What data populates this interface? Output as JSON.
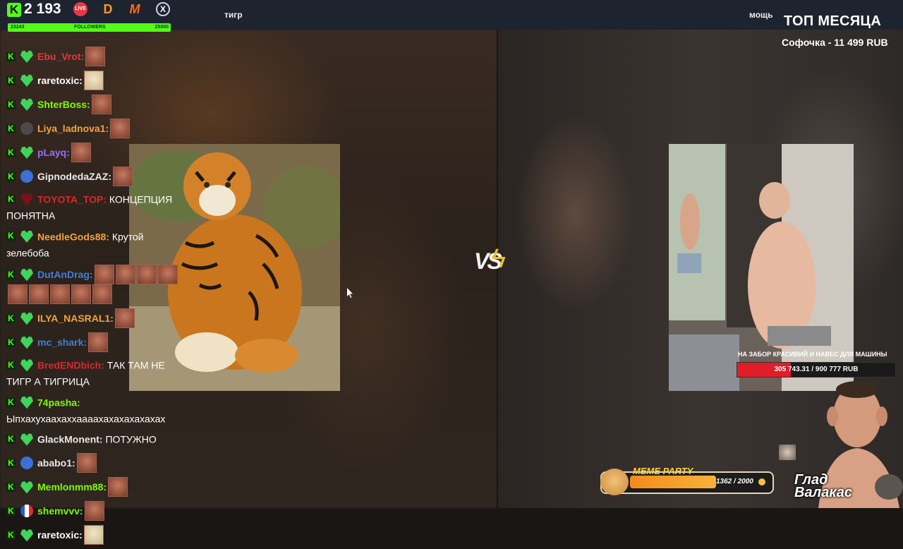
{
  "header": {
    "viewers": "2 193",
    "followers": {
      "current": "23243",
      "label": "FOLLOWERS",
      "goal": "25000",
      "progress": 0.93
    },
    "platforms": [
      {
        "icon": "live-icon",
        "label": "LIVE"
      },
      {
        "icon": "donationalerts-icon",
        "label": "D"
      },
      {
        "icon": "memealerts-icon",
        "label": "M"
      },
      {
        "icon": "x-icon",
        "label": "X"
      }
    ],
    "caption_left": "тигр",
    "caption_right": "мощь",
    "top_month_title": "ТОП МЕСЯЦА",
    "top_donor": "Софочка - 11 499 RUB"
  },
  "chat": [
    {
      "user": "Ebu_Vrot:",
      "color": "#e5383b",
      "badge": "heart",
      "text": ""
    },
    {
      "user": "raretoxic:",
      "color": "#ffffff",
      "badge": "heart",
      "text": ""
    },
    {
      "user": "ShterBoss:",
      "color": "#7cfc00",
      "badge": "heart",
      "text": ""
    },
    {
      "user": "Liya_ladnova1:",
      "color": "#f4a23a",
      "badge": "dark",
      "text": ""
    },
    {
      "user": "pLayq:",
      "color": "#9b6cff",
      "badge": "heart",
      "text": ""
    },
    {
      "user": "GipnodedaZAZ:",
      "color": "#e8e8e8",
      "badge": "blue",
      "text": ""
    },
    {
      "user": "TOYOTA_TOP:",
      "color": "#d62a2a",
      "badge": "red",
      "text": "КОНЦЕПЦИЯ ПОНЯТНА"
    },
    {
      "user": "NeedleGods88:",
      "color": "#f4a23a",
      "badge": "heart",
      "text": "Крутой зелебоба"
    },
    {
      "user": "DutAnDrag:",
      "color": "#3f7fe0",
      "badge": "heart",
      "text": ""
    },
    {
      "user": "ILYA_NASRAL1:",
      "color": "#f4a23a",
      "badge": "heart",
      "text": ""
    },
    {
      "user": "mc_shark:",
      "color": "#3f7fe0",
      "badge": "heart",
      "text": ""
    },
    {
      "user": "BredENDbich:",
      "color": "#d62a2a",
      "badge": "heart",
      "text": "ТАК ТАМ НЕ ТИГР А ТИГРИЦА"
    },
    {
      "user": "74pasha:",
      "color": "#7cfc00",
      "badge": "heart",
      "text": "Ыпхахухаахаххаааахахахахахахах"
    },
    {
      "user": "GlackMonent:",
      "color": "#e8e8e8",
      "badge": "heart",
      "text": "ПОТУЖНО"
    },
    {
      "user": "ababo1:",
      "color": "#e8e8e8",
      "badge": "blue",
      "text": ""
    },
    {
      "user": "Memlonmm88:",
      "color": "#7cfc00",
      "badge": "heart",
      "text": ""
    },
    {
      "user": "shemvvv:",
      "color": "#7cfc00",
      "badge": "fr",
      "text": ""
    },
    {
      "user": "raretoxic:",
      "color": "#ffffff",
      "badge": "heart",
      "text": ""
    }
  ],
  "vs_label": "VS",
  "goal": {
    "title": "НА ЗАБОР КРАСИВИЙ И НАВЕС ДЛЯ МАШИНЫ",
    "progress_text": "305 743.31 / 900 777 RUB",
    "progress": 0.34
  },
  "meme_party": {
    "label": "MEME PARTY",
    "count": "1362 / 2000",
    "progress": 0.68
  },
  "streamer": {
    "name_line1": "Глад",
    "name_line2": "Валакас"
  }
}
